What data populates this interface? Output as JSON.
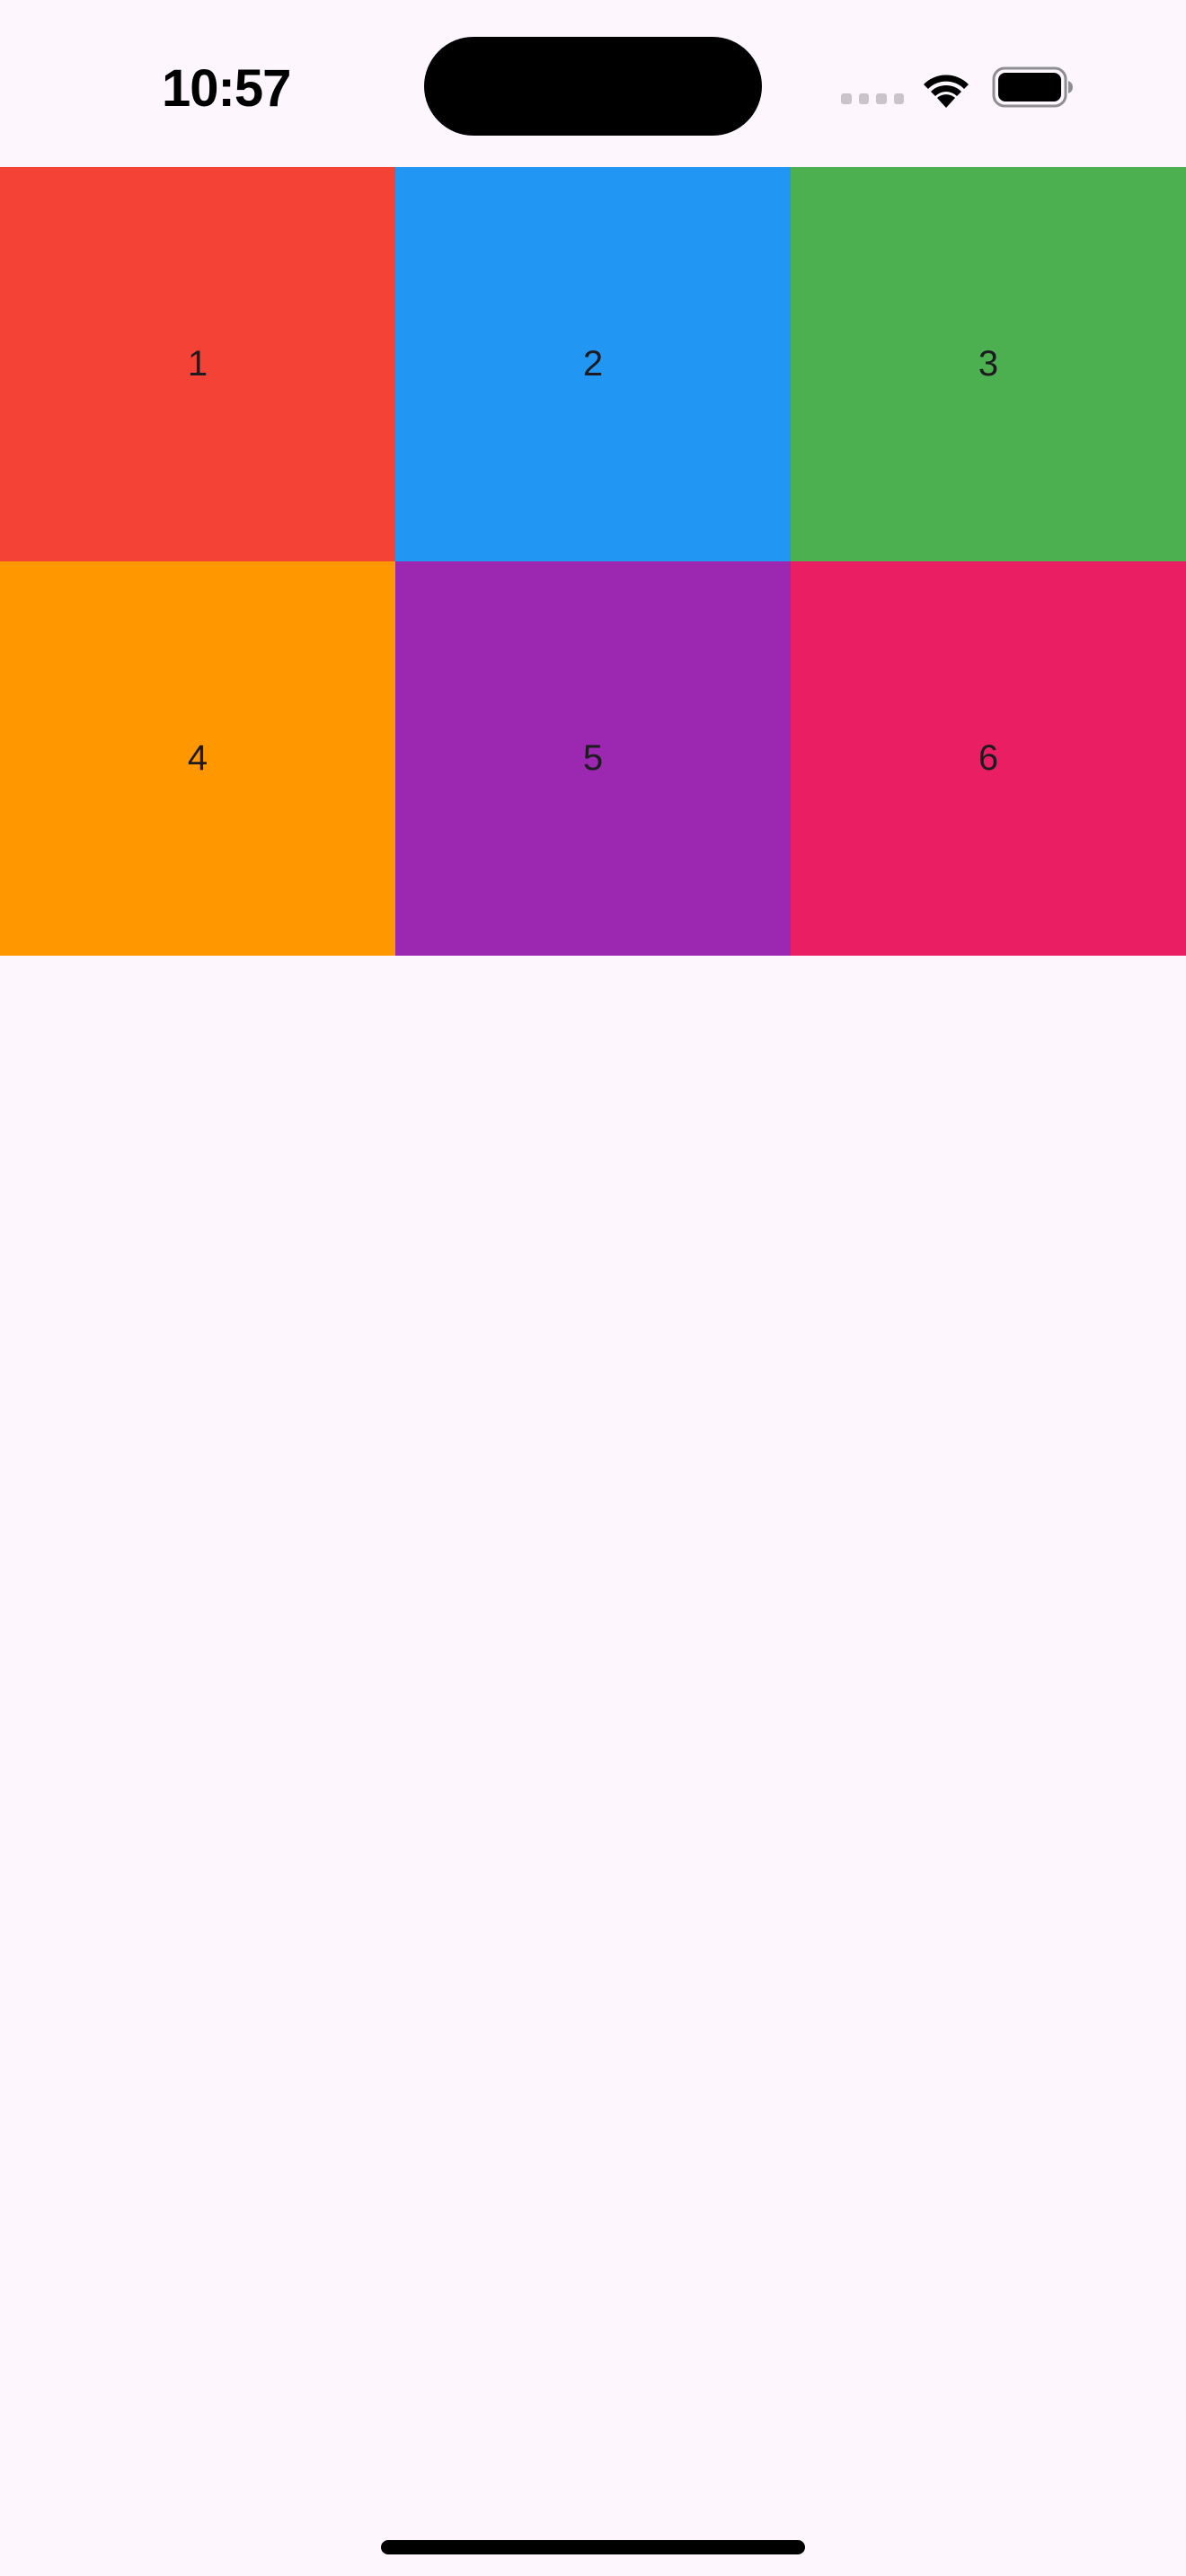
{
  "status_bar": {
    "time": "10:57",
    "icons": [
      "cellular-signal-icon",
      "wifi-icon",
      "battery-icon"
    ]
  },
  "grid": {
    "tiles": [
      {
        "label": "1",
        "color": "#f44336"
      },
      {
        "label": "2",
        "color": "#2196f3"
      },
      {
        "label": "3",
        "color": "#4caf50"
      },
      {
        "label": "4",
        "color": "#ff9800"
      },
      {
        "label": "5",
        "color": "#9c27b0"
      },
      {
        "label": "6",
        "color": "#e91e63"
      }
    ]
  },
  "colors": {
    "background": "#fdf6fd",
    "text": "#1d1b20"
  }
}
